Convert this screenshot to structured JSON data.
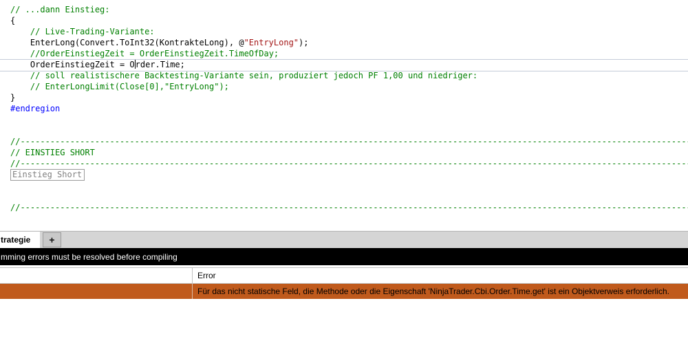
{
  "colors": {
    "comment": "#008000",
    "code": "#000000",
    "string": "#a31515",
    "keyword": "#0000ff",
    "collapsed": "#808080",
    "current_line_border": "#c4ccd8",
    "tabstrip_bg": "#d5d5d5",
    "active_tab_bg": "#ffffff",
    "plus_tab_bg": "#c9c9c9",
    "status_bar_bg": "#000000",
    "status_bar_text": "#ffffff",
    "grid_border": "#c0c0c0",
    "error_row_bg": "#c05a1c",
    "error_row_text": "#000000"
  },
  "editor": {
    "lines": [
      {
        "segs": [
          {
            "t": "// ...dann Einstieg:",
            "s": "comment"
          }
        ]
      },
      {
        "segs": [
          {
            "t": "{",
            "s": "code"
          }
        ]
      },
      {
        "segs": [
          {
            "t": "    ",
            "s": "code"
          },
          {
            "t": "// Live-Trading-Variante:",
            "s": "comment"
          }
        ]
      },
      {
        "segs": [
          {
            "t": "    EnterLong(Convert.ToInt32(KontrakteLong), @",
            "s": "code"
          },
          {
            "t": "\"EntryLong\"",
            "s": "string"
          },
          {
            "t": ");",
            "s": "code"
          }
        ]
      },
      {
        "segs": [
          {
            "t": "    ",
            "s": "code"
          },
          {
            "t": "//OrderEinstiegZeit = OrderEinstiegZeit.TimeOfDay;",
            "s": "comment"
          }
        ]
      },
      {
        "current": true,
        "segs": [
          {
            "t": "    OrderEinstiegZeit = O",
            "s": "code"
          },
          {
            "s": "caret"
          },
          {
            "t": "rder.Time;",
            "s": "code"
          }
        ]
      },
      {
        "segs": [
          {
            "t": "    ",
            "s": "code"
          },
          {
            "t": "// soll realistischere Backtesting-Variante sein, produziert jedoch PF 1,00 und niedriger:",
            "s": "comment"
          }
        ]
      },
      {
        "segs": [
          {
            "t": "    ",
            "s": "code"
          },
          {
            "t": "// EnterLongLimit(Close[0],\"EntryLong\");",
            "s": "comment"
          }
        ]
      },
      {
        "segs": [
          {
            "t": "}",
            "s": "code"
          }
        ]
      },
      {
        "segs": [
          {
            "t": "#endregion",
            "s": "keyword"
          }
        ]
      },
      {
        "segs": []
      },
      {
        "segs": []
      },
      {
        "segs": [
          {
            "t": "//------------------------------------------------------------------------------------------------------------------------------------------------------",
            "s": "comment"
          }
        ]
      },
      {
        "segs": [
          {
            "t": "// EINSTIEG SHORT",
            "s": "comment"
          }
        ]
      },
      {
        "segs": [
          {
            "t": "//------------------------------------------------------------------------------------------------------------------------------------------------------",
            "s": "comment"
          }
        ]
      },
      {
        "segs": [
          {
            "t": "Einstieg Short",
            "s": "collapsed"
          }
        ]
      },
      {
        "segs": []
      },
      {
        "segs": []
      },
      {
        "segs": [
          {
            "t": "//------------------------------------------------------------------------------------------------------------------------------------------------------",
            "s": "comment"
          }
        ]
      }
    ]
  },
  "tabs": {
    "active": "trategie",
    "plus": "+"
  },
  "status_bar": {
    "message": "mming errors must be resolved before compiling"
  },
  "error_grid": {
    "error_column_header": "Error",
    "rows": [
      {
        "error": "Für das nicht statische Feld, die Methode oder die Eigenschaft 'NinjaTrader.Cbi.Order.Time.get' ist ein Objektverweis erforderlich."
      }
    ]
  }
}
